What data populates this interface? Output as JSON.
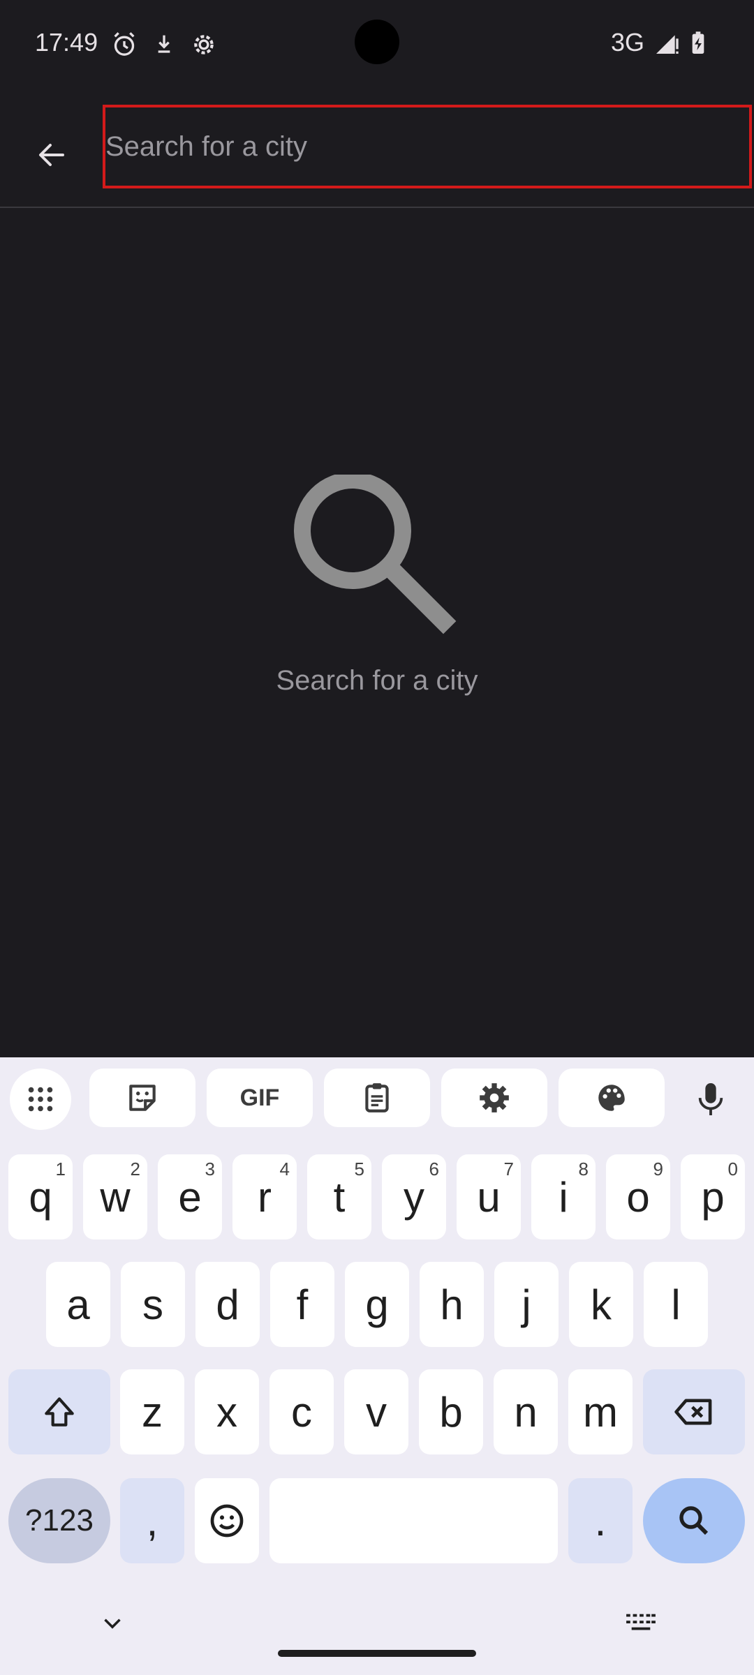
{
  "status_bar": {
    "time": "17:49",
    "network": "3G",
    "icons": [
      "alarm-icon",
      "download-icon",
      "settings-gear-icon",
      "signal-icon",
      "battery-charging-icon"
    ]
  },
  "search": {
    "placeholder": "Search for a city",
    "value": ""
  },
  "empty_state": {
    "icon": "search-icon",
    "text": "Search for a city"
  },
  "keyboard": {
    "toolbar": [
      "apps-grid-icon",
      "sticker-icon",
      "GIF",
      "clipboard-icon",
      "settings-icon",
      "palette-icon",
      "mic-icon"
    ],
    "gif_label": "GIF",
    "row1": [
      {
        "k": "q",
        "h": "1"
      },
      {
        "k": "w",
        "h": "2"
      },
      {
        "k": "e",
        "h": "3"
      },
      {
        "k": "r",
        "h": "4"
      },
      {
        "k": "t",
        "h": "5"
      },
      {
        "k": "y",
        "h": "6"
      },
      {
        "k": "u",
        "h": "7"
      },
      {
        "k": "i",
        "h": "8"
      },
      {
        "k": "o",
        "h": "9"
      },
      {
        "k": "p",
        "h": "0"
      }
    ],
    "row2": [
      "a",
      "s",
      "d",
      "f",
      "g",
      "h",
      "j",
      "k",
      "l"
    ],
    "row3": [
      "z",
      "x",
      "c",
      "v",
      "b",
      "n",
      "m"
    ],
    "symbols_label": "?123",
    "comma_label": ",",
    "period_label": "."
  }
}
